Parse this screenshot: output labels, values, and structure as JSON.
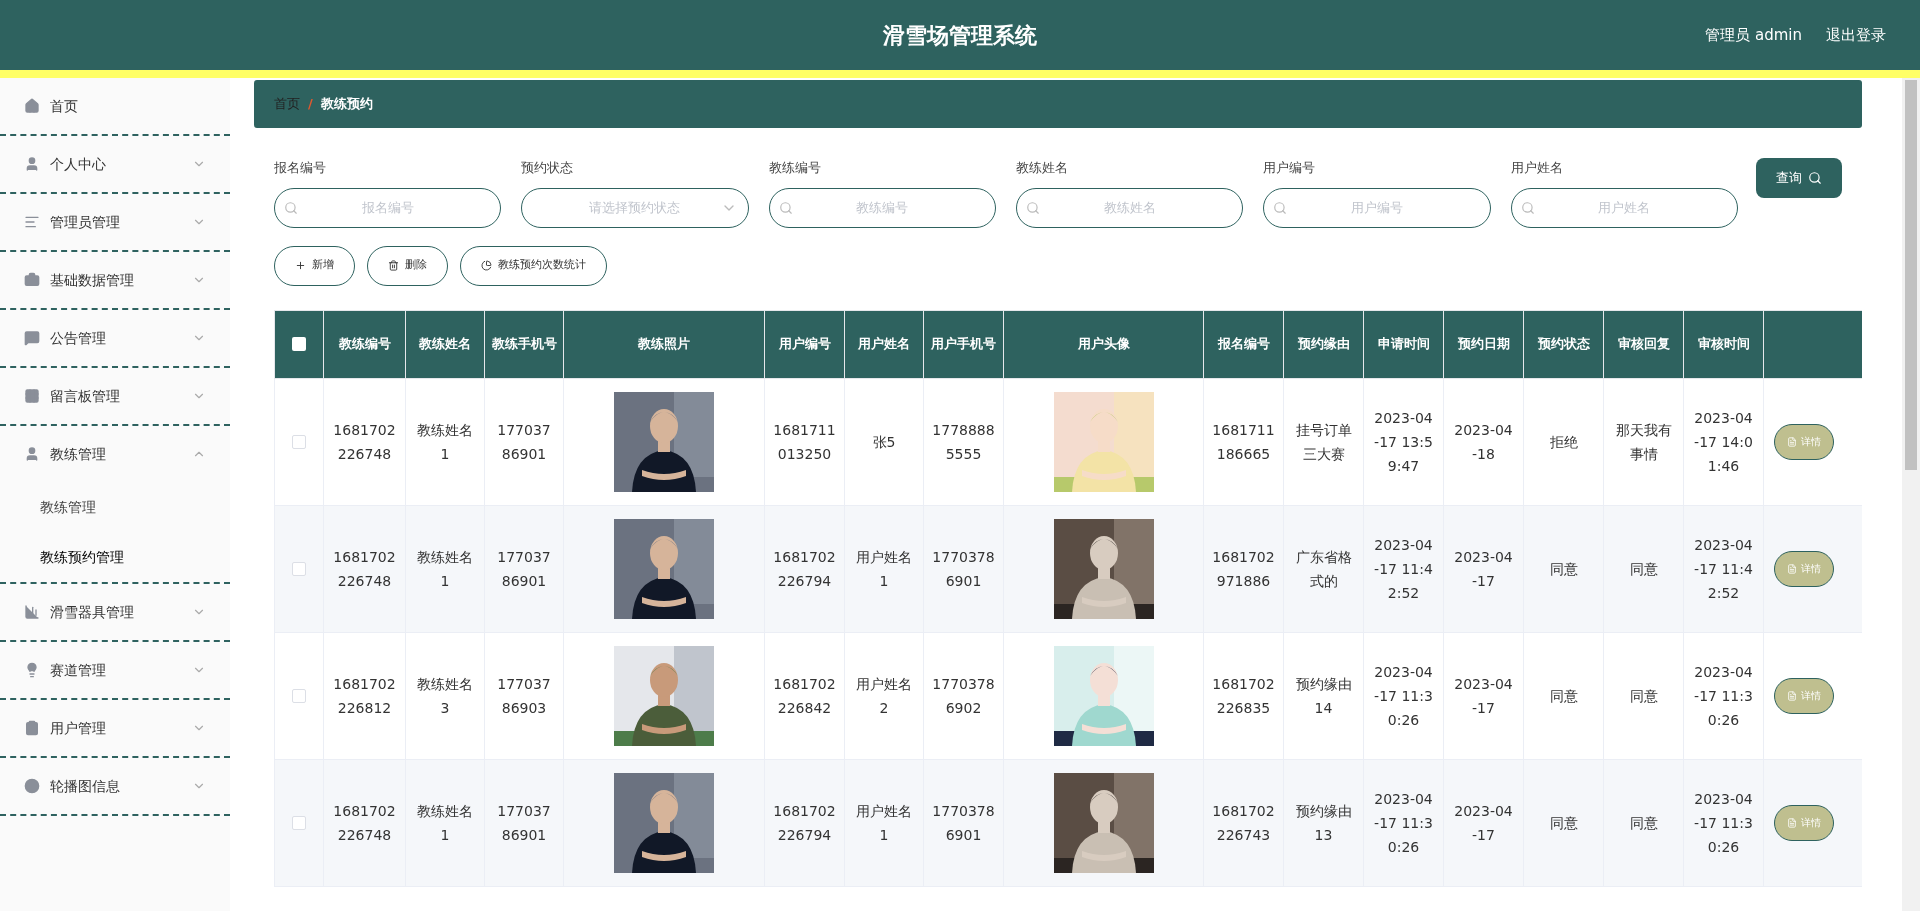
{
  "header": {
    "title": "滑雪场管理系统",
    "user": "管理员 admin",
    "logout": "退出登录"
  },
  "sidebar": {
    "items": [
      {
        "label": "首页",
        "selected": false
      },
      {
        "label": "个人中心",
        "expanded": false,
        "selected": false
      },
      {
        "label": "管理员管理",
        "expanded": false,
        "selected": false
      },
      {
        "label": "基础数据管理",
        "expanded": false,
        "selected": false
      },
      {
        "label": "公告管理",
        "expanded": false,
        "selected": false
      },
      {
        "label": "留言板管理",
        "expanded": false,
        "selected": false
      },
      {
        "label": "教练管理",
        "expanded": true,
        "selected": false,
        "children": [
          {
            "label": "教练管理",
            "selected": false
          },
          {
            "label": "教练预约管理",
            "selected": true
          }
        ]
      },
      {
        "label": "滑雪器具管理",
        "expanded": false,
        "selected": false
      },
      {
        "label": "赛道管理",
        "expanded": false,
        "selected": false
      },
      {
        "label": "用户管理",
        "expanded": false,
        "selected": false
      },
      {
        "label": "轮播图信息",
        "expanded": false,
        "selected": false
      }
    ]
  },
  "breadcrumb": [
    "首页",
    "教练预约"
  ],
  "breadcrumb_separator": "/",
  "filters": [
    {
      "label": "报名编号",
      "placeholder": "报名编号",
      "kind": "text"
    },
    {
      "label": "预约状态",
      "placeholder": "请选择预约状态",
      "kind": "select"
    },
    {
      "label": "教练编号",
      "placeholder": "教练编号",
      "kind": "text"
    },
    {
      "label": "教练姓名",
      "placeholder": "教练姓名",
      "kind": "text"
    },
    {
      "label": "用户编号",
      "placeholder": "用户编号",
      "kind": "text"
    },
    {
      "label": "用户姓名",
      "placeholder": "用户姓名",
      "kind": "text"
    }
  ],
  "query_button": "查询",
  "actions": [
    {
      "label": "新增",
      "kind": "add"
    },
    {
      "label": "删除",
      "kind": "delete"
    },
    {
      "label": "教练预约次数统计",
      "kind": "stats"
    }
  ],
  "table": {
    "all_checked": false,
    "columns": [
      "教练编号",
      "教练姓名",
      "教练手机号",
      "教练照片",
      "用户编号",
      "用户姓名",
      "用户手机号",
      "用户头像",
      "报名编号",
      "预约缘由",
      "申请时间",
      "预约日期",
      "预约状态",
      "审核回复",
      "审核时间"
    ],
    "rows": [
      {
        "checked": false,
        "cells": [
          "1681702226748",
          "教练姓名1",
          "17703786901",
          "",
          "1681711013250",
          "张5",
          "17788885555",
          "",
          "1681711186665",
          "挂号订单三大赛",
          "2023-04-17 13:59:47",
          "2023-04-18",
          "拒绝",
          "那天我有事情",
          "2023-04-17 14:01:46"
        ],
        "action": "详情"
      },
      {
        "checked": false,
        "cells": [
          "1681702226748",
          "教练姓名1",
          "17703786901",
          "",
          "1681702226794",
          "用户姓名1",
          "17703786901",
          "",
          "1681702971886",
          "广东省格式的",
          "2023-04-17 11:42:52",
          "2023-04-17",
          "同意",
          "同意",
          "2023-04-17 11:42:52"
        ],
        "action": "详情"
      },
      {
        "checked": false,
        "cells": [
          "1681702226812",
          "教练姓名3",
          "17703786903",
          "",
          "1681702226842",
          "用户姓名2",
          "17703786902",
          "",
          "1681702226835",
          "预约缘由14",
          "2023-04-17 11:30:26",
          "2023-04-17",
          "同意",
          "同意",
          "2023-04-17 11:30:26"
        ],
        "action": "详情"
      },
      {
        "checked": false,
        "cells": [
          "1681702226748",
          "教练姓名1",
          "17703786901",
          "",
          "1681702226794",
          "用户姓名1",
          "17703786901",
          "",
          "1681702226743",
          "预约缘由13",
          "2023-04-17 11:30:26",
          "2023-04-17",
          "同意",
          "同意",
          "2023-04-17 11:30:26"
        ],
        "action": "详情"
      }
    ]
  }
}
